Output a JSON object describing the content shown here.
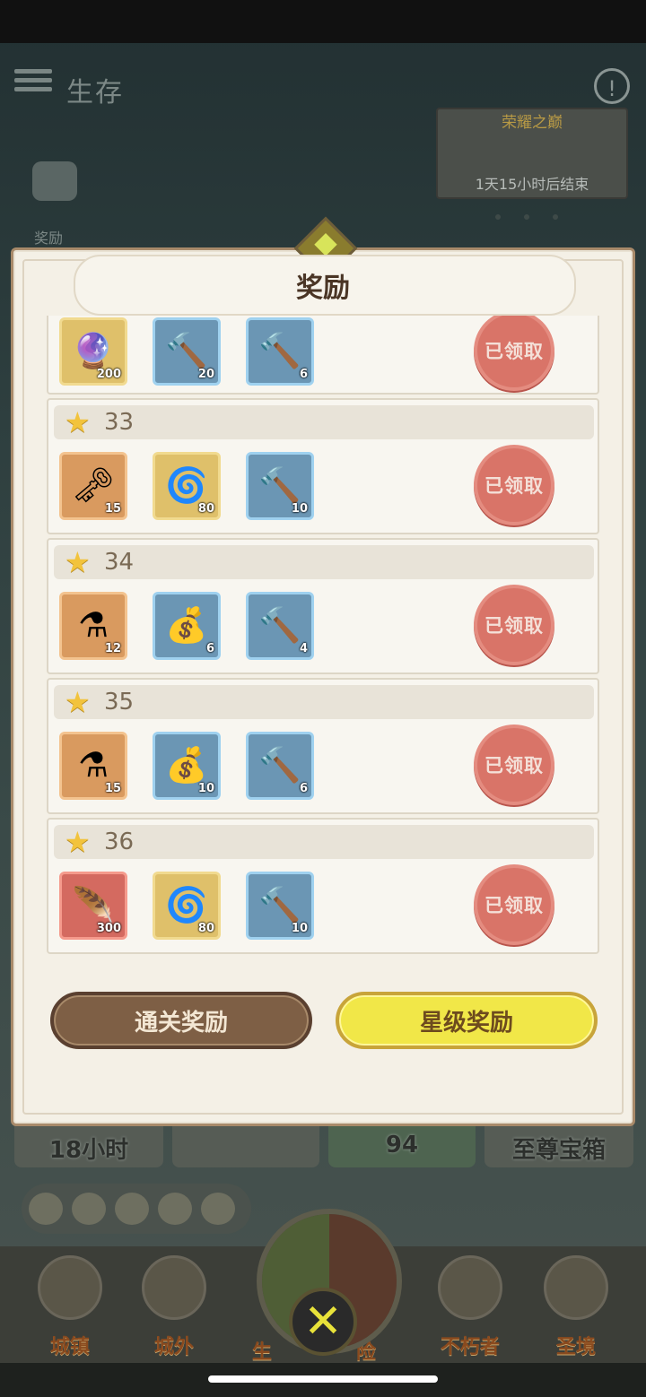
{
  "background": {
    "title": "生存",
    "reward_label": "奖励",
    "event": {
      "title": "荣耀之巅",
      "timer": "1天15小时后结束"
    },
    "cards": [
      "18小时",
      "",
      "94",
      "至尊宝箱"
    ],
    "nav": [
      "城镇",
      "城外",
      "生",
      "险",
      "不朽者",
      "圣境"
    ]
  },
  "modal": {
    "title": "奖励",
    "claimed_label": "已领取",
    "rows": [
      {
        "star": "",
        "items": [
          {
            "icon": "purple-orb-icon",
            "glyph": "🔮",
            "quality": "gold",
            "count": "200"
          },
          {
            "icon": "hammer-big-icon",
            "glyph": "🔨",
            "quality": "blue",
            "count": "20"
          },
          {
            "icon": "hammer-icon",
            "glyph": "🔨",
            "quality": "blue",
            "count": "6"
          }
        ]
      },
      {
        "star": "33",
        "items": [
          {
            "icon": "golden-key-icon",
            "glyph": "🗝",
            "quality": "orange",
            "count": "15"
          },
          {
            "icon": "gold-swirl-icon",
            "glyph": "🌀",
            "quality": "gold",
            "count": "80"
          },
          {
            "icon": "hammer-icon",
            "glyph": "🔨",
            "quality": "blue",
            "count": "10"
          }
        ]
      },
      {
        "star": "34",
        "items": [
          {
            "icon": "potion-icon",
            "glyph": "⚗",
            "quality": "orange",
            "count": "12"
          },
          {
            "icon": "blue-pouch-icon",
            "glyph": "💰",
            "quality": "blue",
            "count": "6"
          },
          {
            "icon": "hammer-icon",
            "glyph": "🔨",
            "quality": "blue",
            "count": "4"
          }
        ]
      },
      {
        "star": "35",
        "items": [
          {
            "icon": "potion-icon",
            "glyph": "⚗",
            "quality": "orange",
            "count": "15"
          },
          {
            "icon": "blue-pouch-icon",
            "glyph": "💰",
            "quality": "blue",
            "count": "10"
          },
          {
            "icon": "hammer-icon",
            "glyph": "🔨",
            "quality": "blue",
            "count": "6"
          }
        ]
      },
      {
        "star": "36",
        "items": [
          {
            "icon": "feather-icon",
            "glyph": "🪶",
            "quality": "red",
            "count": "300"
          },
          {
            "icon": "gold-swirl-icon",
            "glyph": "🌀",
            "quality": "gold",
            "count": "80"
          },
          {
            "icon": "hammer-icon",
            "glyph": "🔨",
            "quality": "blue",
            "count": "10"
          }
        ]
      }
    ],
    "tabs": {
      "pass": "通关奖励",
      "star": "星级奖励",
      "active": "star"
    }
  },
  "colors": {
    "seal": "#d97468",
    "tab_active": "#f1e748",
    "tab_inactive": "#7e5f45"
  }
}
